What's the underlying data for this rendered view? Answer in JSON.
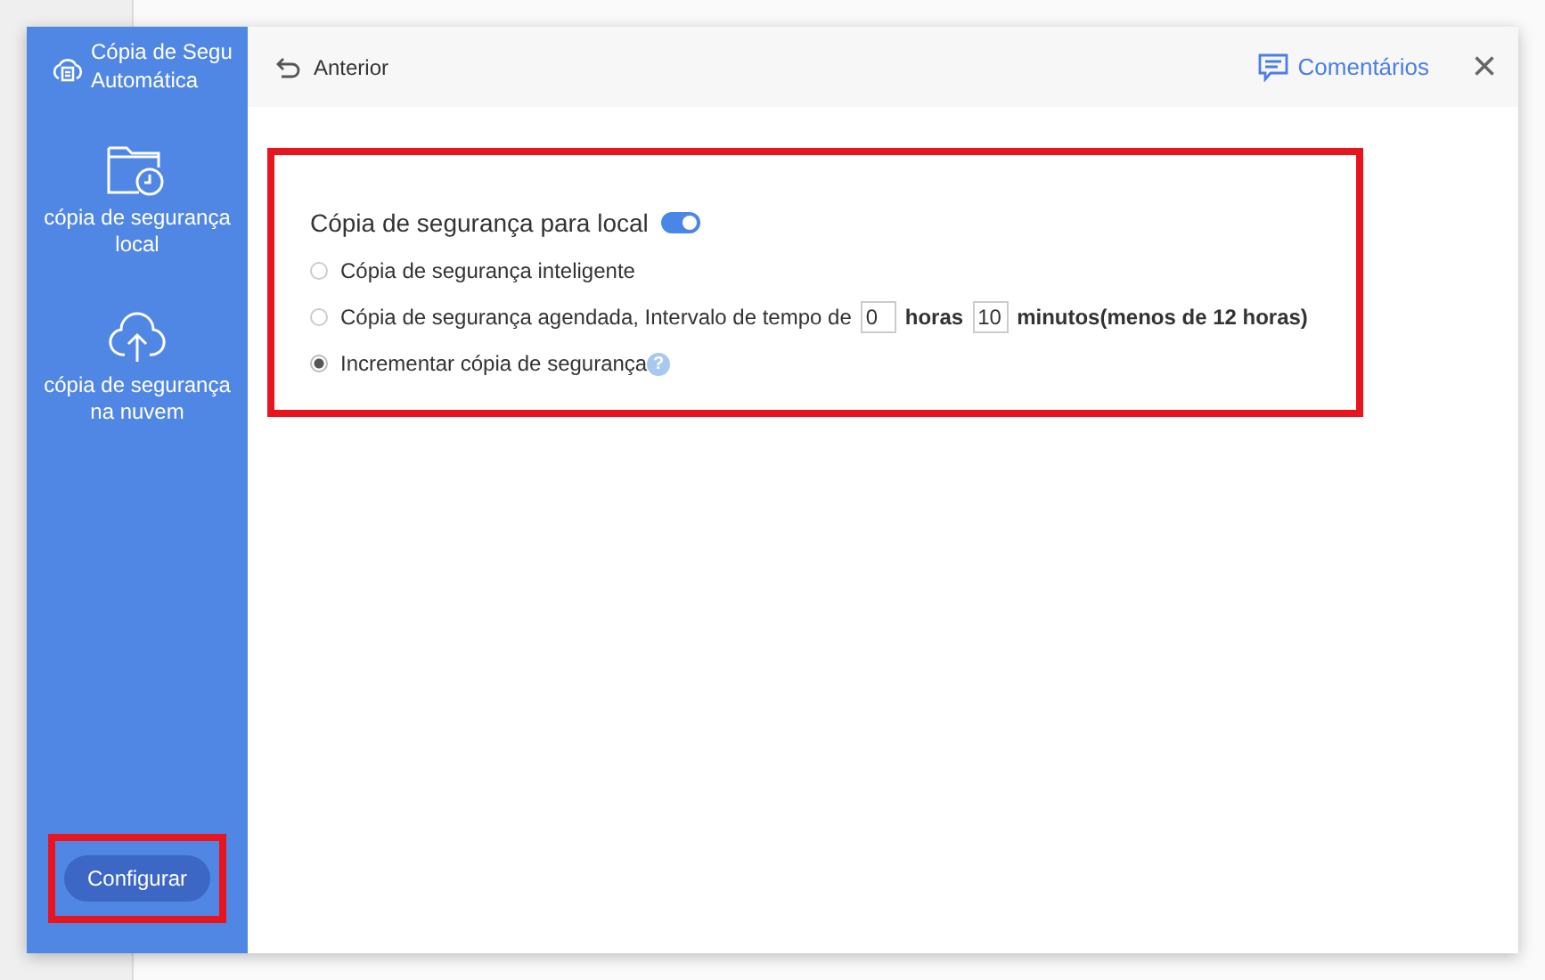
{
  "sidebar": {
    "app_title": "Cópia de Segu Automática",
    "items": [
      {
        "label": "cópia de segurança local",
        "kind": "folder-clock",
        "selected": false
      },
      {
        "label": "cópia de segurança na nuvem",
        "kind": "cloud-upload",
        "selected": false
      }
    ],
    "settings_button": {
      "label": "Configurar",
      "highlighted": true
    }
  },
  "header": {
    "back": "Anterior",
    "feedback": "Comentários",
    "close": "×"
  },
  "section": {
    "highlighted": true,
    "title": "Cópia de segurança para local",
    "toggle_on": true,
    "options": [
      {
        "selected": false,
        "parts": [
          {
            "kind": "text",
            "text": "Cópia de segurança inteligente"
          }
        ]
      },
      {
        "selected": false,
        "parts": [
          {
            "kind": "text",
            "text": "Cópia de segurança agendada, Intervalo de tempo de"
          },
          {
            "kind": "input",
            "value": "0"
          },
          {
            "kind": "bold",
            "text": "horas"
          },
          {
            "kind": "input",
            "value": "10"
          },
          {
            "kind": "bold",
            "text": "minutos(menos de 12 horas)"
          }
        ]
      },
      {
        "selected": true,
        "help": "?",
        "parts": [
          {
            "kind": "text",
            "text": "Incrementar cópia de segurança"
          }
        ]
      }
    ]
  }
}
